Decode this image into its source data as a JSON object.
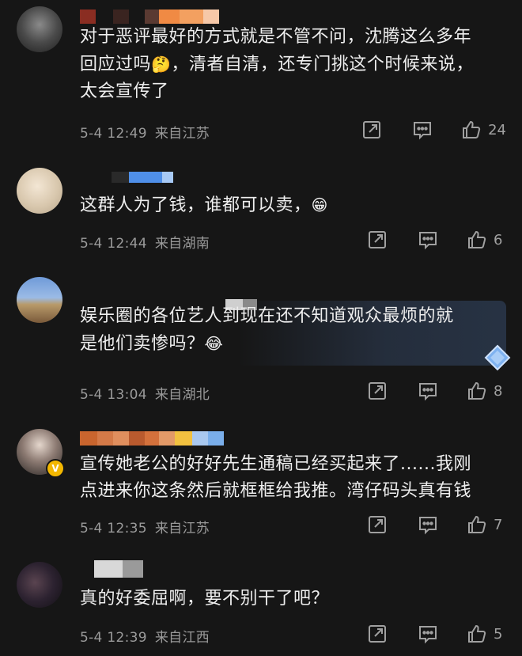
{
  "comments": [
    {
      "text_lines": [
        "对于恶评最好的方式就是不管不问，沈腾这么多年",
        "回应过吗",
        "，清者自清，还专门挑这个时候来说，",
        "太会宣传了"
      ],
      "date": "5-4 12:49",
      "location": "来自江苏",
      "likes": "24"
    },
    {
      "text": "这群人为了钱，谁都可以卖，",
      "date": "5-4 12:44",
      "location": "来自湖南",
      "likes": "6"
    },
    {
      "text_lines": [
        "娱乐圈的各位艺人到现在还不知道观众最烦的就",
        "是他们卖惨吗？"
      ],
      "date": "5-4 13:04",
      "location": "来自湖北",
      "likes": "8"
    },
    {
      "text_lines": [
        "宣传她老公的好好先生通稿已经买起来了......我刚",
        "点进来你这条然后就框框给我推。湾仔码头真有钱"
      ],
      "date": "5-4 12:35",
      "location": "来自江苏",
      "likes": "7"
    },
    {
      "text": "真的好委屈啊，要不别干了吧？",
      "date": "5-4 12:39",
      "location": "来自江西",
      "likes": "5"
    }
  ],
  "icons": {
    "share": "share-icon",
    "comment": "comment-icon",
    "like": "thumbs-up-icon"
  },
  "colors": {
    "background": "#161616",
    "meta_text": "#9a9a9a",
    "verified_badge": "#f3b700"
  }
}
